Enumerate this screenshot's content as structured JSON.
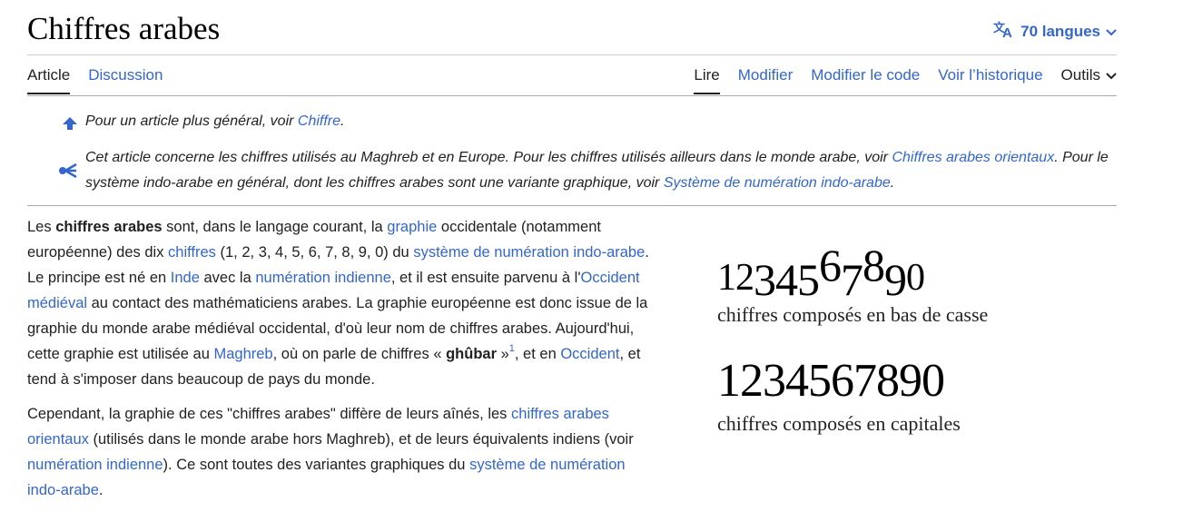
{
  "header": {
    "title": "Chiffres arabes",
    "languages": "70 langues"
  },
  "tabs": {
    "article": "Article",
    "discussion": "Discussion",
    "read": "Lire",
    "edit": "Modifier",
    "edit_code": "Modifier le code",
    "history": "Voir l’historique",
    "tools": "Outils"
  },
  "hatnotes": {
    "general": {
      "text": "Pour un article plus général, voir ",
      "link": "Chiffre",
      "end": "."
    },
    "disambig": {
      "text1": "Cet article concerne les chiffres utilisés au Maghreb et en Europe. Pour les chiffres utilisés ailleurs dans le monde arabe, voir ",
      "link1": "Chiffres arabes orientaux",
      "text2": ". Pour le système indo-arabe en général, dont les chiffres arabes sont une variante graphique, voir ",
      "link2": "Système de numération indo-arabe",
      "end": "."
    }
  },
  "p1": {
    "t1": "Les ",
    "b1": "chiffres arabes",
    "t2": " sont, dans le langage courant, la ",
    "l1": "graphie",
    "t3": " occidentale (notamment européenne) des dix ",
    "l2": "chiffres",
    "t4": " (1, 2, 3, 4, 5, 6, 7, 8, 9, 0) du ",
    "l3": "système de numération indo-arabe",
    "t5": ". Le principe est né en ",
    "l4": "Inde",
    "t6": " avec la ",
    "l5": "numération indienne",
    "t7": ", et il est ensuite parvenu à l'",
    "l6": "Occident médiéval",
    "t8": " au contact des mathématiciens arabes. La graphie européenne est donc issue de la graphie du monde arabe médiéval occidental, d'où leur nom de chiffres arabes. Aujourd'hui, cette graphie est utilisée au ",
    "l7": "Maghreb",
    "t9": ", où on parle de chiffres « ",
    "b2": "ghûbar",
    "t10": " »",
    "sup": "1",
    "t11": ", et en ",
    "l8": "Occident",
    "t12": ", et tend à s'imposer dans beaucoup de pays du monde."
  },
  "p2": {
    "t1": "Cependant, la graphie de ces \"chiffres arabes\" diffère de leurs aînés, les ",
    "l1": "chiffres arabes orientaux",
    "t2": " (utilisés dans le monde arabe hors Maghreb), et de leurs équivalents indiens (voir ",
    "l2": "numération indienne",
    "t3": "). Ce sont toutes des variantes graphiques du ",
    "l3": "système de numération indo-arabe",
    "t4": "."
  },
  "figure": {
    "digits": "1234567890",
    "caption_lower": "chiffres composés en bas de casse",
    "caption_caps": "chiffres composés en capitales"
  }
}
